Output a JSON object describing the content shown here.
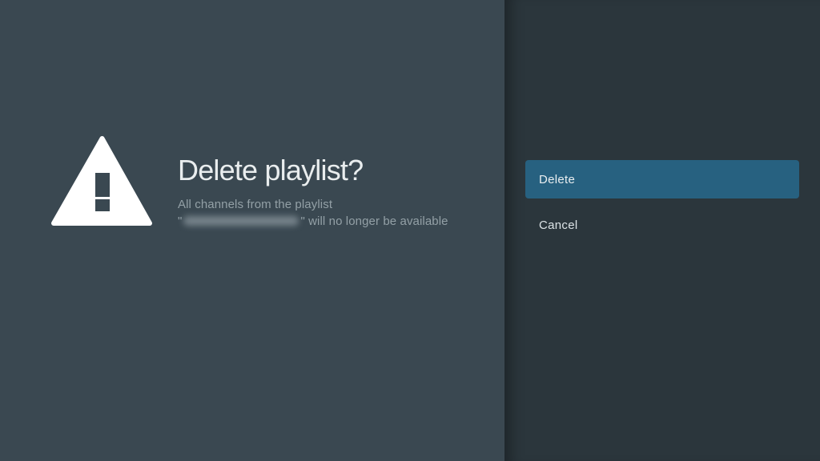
{
  "dialog": {
    "icon": "warning-triangle-icon",
    "title": "Delete playlist?",
    "description_line1": "All channels from the playlist",
    "quote_open": "\"",
    "playlist_name_redacted": true,
    "description_line2_suffix": "\" will no longer be available"
  },
  "actions": [
    {
      "label": "Delete",
      "focused": true
    },
    {
      "label": "Cancel",
      "focused": false
    }
  ],
  "colors": {
    "background_left": "#3a4851",
    "background_actions_panel": "#2b363c",
    "focused_action_blue": "#276180",
    "title_text": "#e9edee",
    "description_text": "#93a0a6",
    "icon_fill": "#ffffff"
  }
}
